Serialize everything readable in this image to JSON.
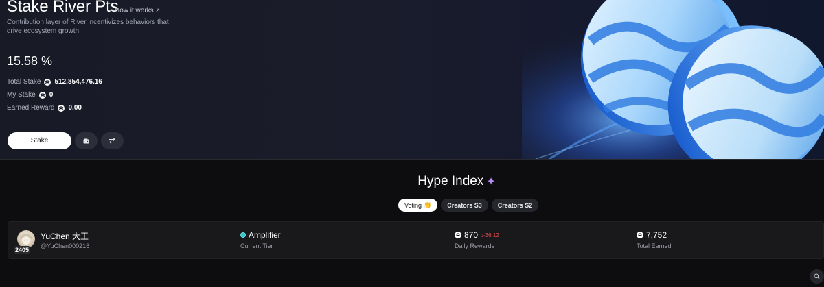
{
  "hero": {
    "title": "Stake River Pts",
    "how_link": "How it works",
    "how_link_arrow": "↗",
    "description": "Contribution layer of River incentivizes behaviors that drive ecosystem growth",
    "apr": "15.58 %",
    "stats": [
      {
        "label": "Total Stake",
        "value": "512,854,476.16",
        "icon": "river-icon"
      },
      {
        "label": "My Stake",
        "value": "0",
        "icon": "river-icon"
      },
      {
        "label": "Earned Reward",
        "value": "0.00",
        "icon": "river-icon"
      }
    ],
    "stake_button": "Stake",
    "wallet_button_icon": "wallet-icon",
    "swap_button_icon": "swap-arrows-icon"
  },
  "hype": {
    "title": "Hype Index",
    "title_icon": "sparkle-icon",
    "tabs": [
      {
        "label": "Voting",
        "active": true,
        "emoji": "👏"
      },
      {
        "label": "Creators S3",
        "active": false
      },
      {
        "label": "Creators S2",
        "active": false
      }
    ]
  },
  "user": {
    "name": "YuChen 大王",
    "handle": "@YuChen000216",
    "rank": "2405",
    "tier": "Amplifier",
    "tier_label": "Current Tier",
    "daily_rewards": "870",
    "daily_delta": "↓-36.12",
    "daily_label": "Daily Rewards",
    "total_earned": "7,752",
    "total_label": "Total Earned"
  },
  "colors": {
    "accent_tier": "#33c6c6",
    "negative": "#e24a4a",
    "sparkle": "#b58cf5"
  }
}
